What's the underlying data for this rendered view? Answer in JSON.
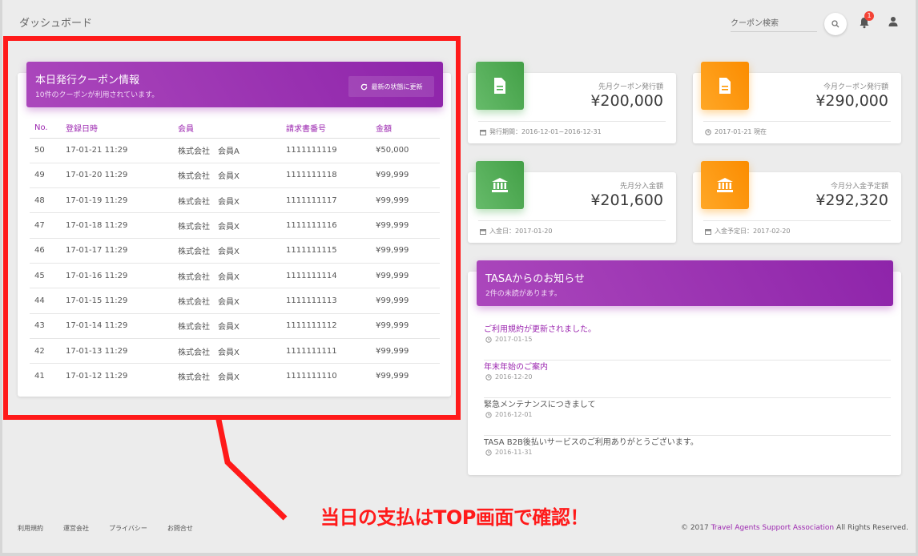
{
  "header": {
    "brand": "ダッシュボード",
    "search_placeholder": "クーポン検索",
    "notification_count": "1"
  },
  "coupons": {
    "title": "本日発行クーポン情報",
    "subtitle": "10件のクーポンが利用されています。",
    "refresh_label": "最新の状態に更新",
    "columns": [
      "No.",
      "登録日時",
      "会員",
      "請求書番号",
      "金額"
    ],
    "rows": [
      [
        "50",
        "17-01-21 11:29",
        "株式会社　会員A",
        "1111111119",
        "¥50,000"
      ],
      [
        "49",
        "17-01-20 11:29",
        "株式会社　会員X",
        "1111111118",
        "¥99,999"
      ],
      [
        "48",
        "17-01-19 11:29",
        "株式会社　会員X",
        "1111111117",
        "¥99,999"
      ],
      [
        "47",
        "17-01-18 11:29",
        "株式会社　会員X",
        "1111111116",
        "¥99,999"
      ],
      [
        "46",
        "17-01-17 11:29",
        "株式会社　会員X",
        "1111111115",
        "¥99,999"
      ],
      [
        "45",
        "17-01-16 11:29",
        "株式会社　会員X",
        "1111111114",
        "¥99,999"
      ],
      [
        "44",
        "17-01-15 11:29",
        "株式会社　会員X",
        "1111111113",
        "¥99,999"
      ],
      [
        "43",
        "17-01-14 11:29",
        "株式会社　会員X",
        "1111111112",
        "¥99,999"
      ],
      [
        "42",
        "17-01-13 11:29",
        "株式会社　会員X",
        "1111111111",
        "¥99,999"
      ],
      [
        "41",
        "17-01-12 11:29",
        "株式会社　会員X",
        "1111111110",
        "¥99,999"
      ]
    ]
  },
  "stats": [
    {
      "label": "先月クーポン発行額",
      "value": "¥200,000",
      "footer": "発行期間：2016-12-01~2016-12-31",
      "icon": "document-icon",
      "color": "#4caf50"
    },
    {
      "label": "今月クーポン発行額",
      "value": "¥290,000",
      "footer": "2017-01-21 現在",
      "icon": "document-icon",
      "color": "#ff9800"
    },
    {
      "label": "先月分入金額",
      "value": "¥201,600",
      "footer": "入金日：2017-01-20",
      "icon": "bank-icon",
      "color": "#4caf50"
    },
    {
      "label": "今月分入金予定額",
      "value": "¥292,320",
      "footer": "入金予定日：2017-02-20",
      "icon": "bank-icon",
      "color": "#ff9800"
    }
  ],
  "notices": {
    "title": "TASAからのお知らせ",
    "subtitle": "2件の未読があります。",
    "items": [
      {
        "text": "ご利用規約が更新されました。",
        "date": "2017-01-15",
        "unread": true
      },
      {
        "text": "年末年始のご案内",
        "date": "2016-12-20",
        "unread": true
      },
      {
        "text": "緊急メンテナンスにつきまして",
        "date": "2016-12-01",
        "unread": false
      },
      {
        "text": "TASA B2B後払いサービスのご利用ありがとうございます。",
        "date": "2016-11-31",
        "unread": false
      }
    ]
  },
  "footer": {
    "links": [
      "利用規約",
      "運営会社",
      "プライバシー",
      "お問合せ"
    ],
    "copyright_prefix": "© 2017",
    "copyright_org": "Travel Agents Support Association",
    "copyright_suffix": "All Rights Reserved."
  },
  "annotation": "当日の支払はTOP画面で確認！"
}
